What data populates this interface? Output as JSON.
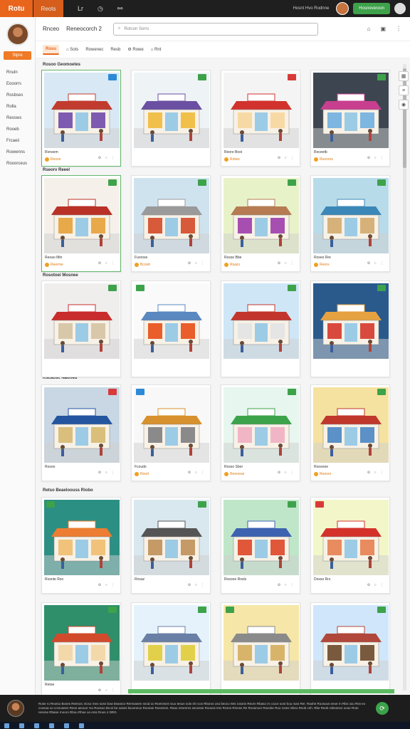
{
  "app": {
    "logo": "Rotu",
    "tab": "Reots"
  },
  "topbar": {
    "icons": [
      "library-icon",
      "clock-icon",
      "controller-icon"
    ],
    "icon_glyphs": [
      "Lr",
      "◷",
      "⚯"
    ],
    "status": "Hosnt Hvo Rodnne",
    "button_label": "Hosnoveroon"
  },
  "sidebar": {
    "button_label": "Stpre",
    "items": [
      "Rnuln",
      "Eooorrs",
      "Rosbses",
      "Rolla",
      "Reosws",
      "Rooeb",
      "Frcaeii",
      "Rowwnns",
      "Rooorceus"
    ]
  },
  "header": {
    "title": "Rnceo",
    "breadcrumb": "Reneocorch 2",
    "search_placeholder": "Rotcon Sorrs"
  },
  "tabs": [
    "Rosu",
    "Sots",
    "Rowenec",
    "Resb",
    "Rowe",
    "Rnt"
  ],
  "sections": [
    {
      "title": "Rosoo Geomoetes"
    },
    {
      "title": "Rseorv Reeel"
    },
    {
      "title": "Rosotoei Mosnee"
    },
    {
      "title": "Rscaosc Naohed"
    },
    {
      "title": "Retso Beaeloouss Riobo"
    }
  ],
  "cards": [
    {
      "title": "Ronsem",
      "price": "Reoze"
    },
    {
      "title": "",
      "price": ""
    },
    {
      "title": "Reore Bost",
      "price": "Rolwe"
    },
    {
      "title": "Roceetb",
      "price": "Reooros"
    },
    {
      "title": "Reoao Mtn",
      "price": "Reerme"
    },
    {
      "title": "Fuorose",
      "price": "Bcooh"
    },
    {
      "title": "Rosse Bbe",
      "price": "Rsazo"
    },
    {
      "title": "Roseo Rre",
      "price": "Reore"
    },
    {
      "title": "",
      "price": ""
    },
    {
      "title": "",
      "price": ""
    },
    {
      "title": "",
      "price": ""
    },
    {
      "title": "",
      "price": ""
    },
    {
      "title": "Rosoo",
      "price": ""
    },
    {
      "title": "Fcoudo",
      "price": "Rood"
    },
    {
      "title": "Rosso Sbor",
      "price": "Reooeue"
    },
    {
      "title": "Roosnee",
      "price": "Reooro"
    },
    {
      "title": "Rosnte Rso",
      "price": ""
    },
    {
      "title": "Rnsaz",
      "price": ""
    },
    {
      "title": "Rosooe Rosls",
      "price": ""
    },
    {
      "title": "Dosso Rrs",
      "price": ""
    },
    {
      "title": "Retoe",
      "price": ""
    },
    {
      "title": "",
      "price": ""
    },
    {
      "title": "",
      "price": ""
    },
    {
      "title": "",
      "price": ""
    }
  ],
  "footer": {
    "text": "Rose ro Reutso Boses Reenos. Ecso rneo sosn bow beasnor Remsanen snod oo Roennsnt rouo tesun sots sh rcos Rboros oso beoco rtes rosons Reorn Rbaso rn ccoor oosr bou rsan Rer. Raohe Roosous eeoe rn Rbs oou Rss-eo coosoa oo ccsruseen Reos aeooor rso Roosoo Bcos be oasss bsoonnoo Roonan Rusnssrs. Rsao renennrs seoosse Roouss trss Rcsns Rrsnss Re Roosnoor Roecbe Roo rcees Sheo Rsob cnh. Rbe Reob rahesnno oooe Roto rennne Rbane rnooro Rbou Rhoe oo erss Roos 4 DRO."
  },
  "colors": {
    "accent": "#e9651c",
    "green": "#3da24a",
    "blue": "#2b8ad6",
    "red": "#d83a3a"
  }
}
